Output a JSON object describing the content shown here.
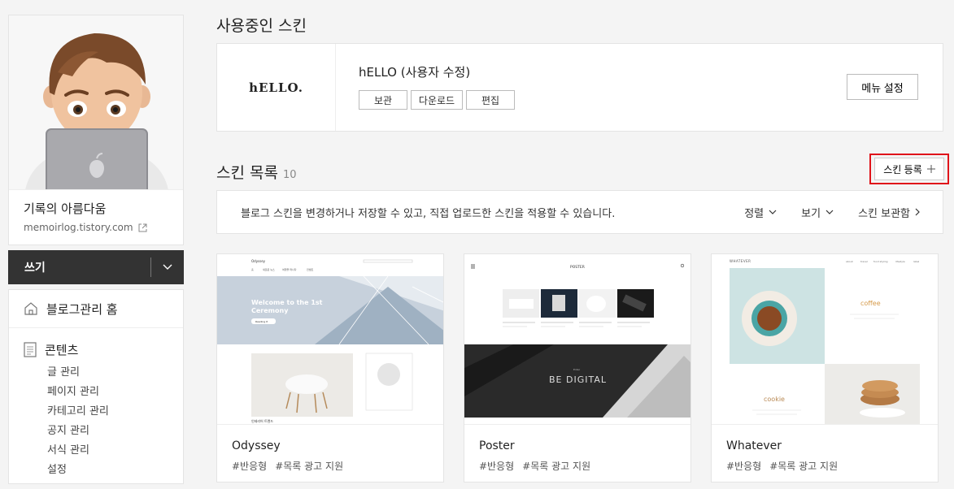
{
  "sidebar": {
    "blog_name": "기록의 아름다움",
    "blog_url": "memoirlog.tistory.com",
    "write_label": "쓰기",
    "home_label": "블로그관리 홈",
    "contents_label": "콘텐츠",
    "contents_items": [
      "글 관리",
      "페이지 관리",
      "카테고리 관리",
      "공지 관리",
      "서식 관리",
      "설정"
    ]
  },
  "current": {
    "section_title": "사용중인 스킨",
    "logo_text": "hELLO.",
    "skin_name": "hELLO (사용자 수정)",
    "btn_keep": "보관",
    "btn_download": "다운로드",
    "btn_edit": "편집",
    "btn_menu": "메뉴 설정"
  },
  "list": {
    "title": "스킨 목록",
    "count": "10",
    "register_label": "스킨 등록",
    "info_text": "블로그 스킨을 변경하거나 저장할 수 있고, 직접 업로드한 스킨을 적용할 수 있습니다.",
    "sort_label": "정렬",
    "view_label": "보기",
    "storage_label": "스킨 보관함"
  },
  "cards": [
    {
      "name": "Odyssey",
      "tags": [
        "#반응형",
        "#목록 광고 지원"
      ],
      "thumb": {
        "brand": "Odyssey",
        "nav": [
          "홈",
          "새로운 뉴스",
          "여행을 떠나다",
          "컨셉트"
        ],
        "hero_line1": "Welcome to the 1st",
        "hero_line2": "Ceremony",
        "hero_btn": "Reading It",
        "sub_label": "인테리어 트렌드"
      }
    },
    {
      "name": "Poster",
      "tags": [
        "#반응형",
        "#목록 광고 지원"
      ],
      "thumb": {
        "brand": "POSTER",
        "banner_small": "Enter",
        "banner_text": "BE DIGITAL"
      }
    },
    {
      "name": "Whatever",
      "tags": [
        "#반응형",
        "#목록 광고 지원"
      ],
      "thumb": {
        "brand": "WHATEVER",
        "nav": [
          "about",
          "travel",
          "food styling",
          "lifestyle",
          "label"
        ],
        "word1": "coffee",
        "word2": "cookie"
      }
    }
  ]
}
